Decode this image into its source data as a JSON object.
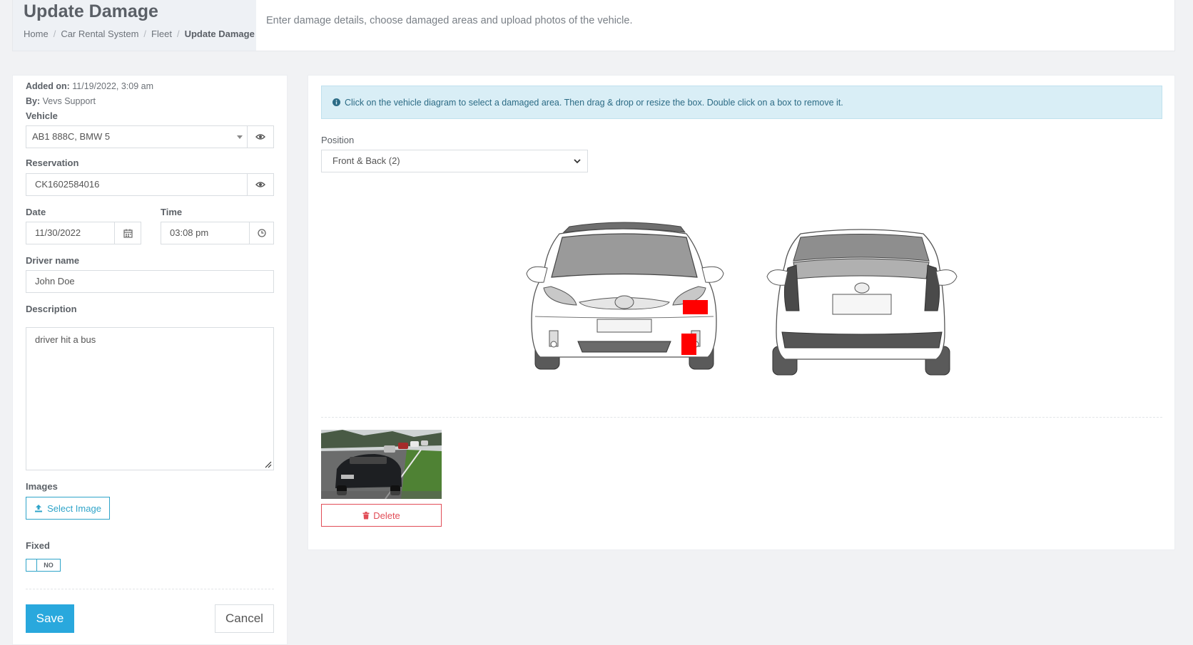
{
  "header": {
    "title": "Update Damage",
    "breadcrumb": [
      "Home",
      "Car Rental System",
      "Fleet",
      "Update Damage"
    ],
    "description": "Enter damage details, choose damaged areas and upload photos of the vehicle."
  },
  "form": {
    "added_on_label": "Added on:",
    "added_on_value": "11/19/2022, 3:09 am",
    "by_label": "By:",
    "by_value": "Vevs Support",
    "vehicle_label": "Vehicle",
    "vehicle_value": "AB1 888C, BMW 5",
    "reservation_label": "Reservation",
    "reservation_value": "CK1602584016",
    "date_label": "Date",
    "date_value": "11/30/2022",
    "time_label": "Time",
    "time_value": "03:08 pm",
    "driver_label": "Driver name",
    "driver_value": "John Doe",
    "description_label": "Description",
    "description_value": "driver hit a bus",
    "images_label": "Images",
    "select_image_label": "Select Image",
    "fixed_label": "Fixed",
    "fixed_state": "NO",
    "save_label": "Save",
    "cancel_label": "Cancel"
  },
  "diagram": {
    "info_text": "Click on the vehicle diagram to select a damaged area. Then drag & drop or resize the box. Double click on a box to remove it.",
    "position_label": "Position",
    "position_value": "Front & Back (2)",
    "damage_marker_color": "#ff0000",
    "delete_label": "Delete"
  },
  "colors": {
    "accent": "#29a8dd",
    "danger": "#e14d57",
    "info_bg": "#d9eef6"
  }
}
